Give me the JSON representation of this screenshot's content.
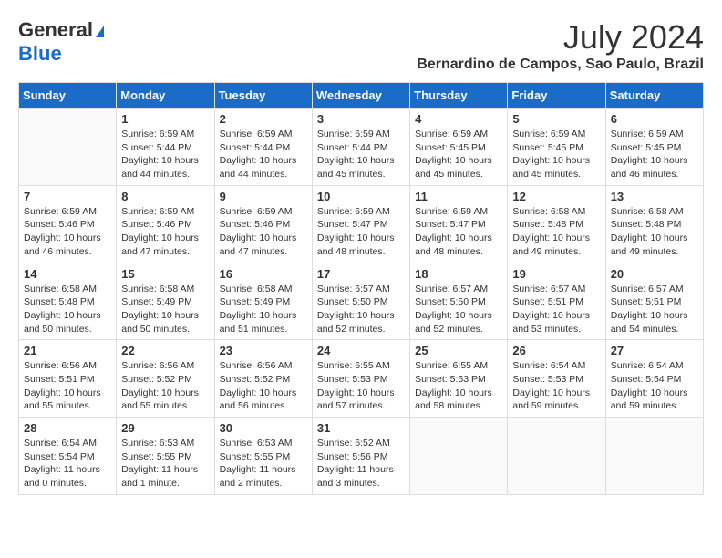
{
  "header": {
    "logo_general": "General",
    "logo_blue": "Blue",
    "month_title": "July 2024",
    "location": "Bernardino de Campos, Sao Paulo, Brazil"
  },
  "days_of_week": [
    "Sunday",
    "Monday",
    "Tuesday",
    "Wednesday",
    "Thursday",
    "Friday",
    "Saturday"
  ],
  "weeks": [
    [
      {
        "day": "",
        "info": ""
      },
      {
        "day": "1",
        "info": "Sunrise: 6:59 AM\nSunset: 5:44 PM\nDaylight: 10 hours\nand 44 minutes."
      },
      {
        "day": "2",
        "info": "Sunrise: 6:59 AM\nSunset: 5:44 PM\nDaylight: 10 hours\nand 44 minutes."
      },
      {
        "day": "3",
        "info": "Sunrise: 6:59 AM\nSunset: 5:44 PM\nDaylight: 10 hours\nand 45 minutes."
      },
      {
        "day": "4",
        "info": "Sunrise: 6:59 AM\nSunset: 5:45 PM\nDaylight: 10 hours\nand 45 minutes."
      },
      {
        "day": "5",
        "info": "Sunrise: 6:59 AM\nSunset: 5:45 PM\nDaylight: 10 hours\nand 45 minutes."
      },
      {
        "day": "6",
        "info": "Sunrise: 6:59 AM\nSunset: 5:45 PM\nDaylight: 10 hours\nand 46 minutes."
      }
    ],
    [
      {
        "day": "7",
        "info": "Sunrise: 6:59 AM\nSunset: 5:46 PM\nDaylight: 10 hours\nand 46 minutes."
      },
      {
        "day": "8",
        "info": "Sunrise: 6:59 AM\nSunset: 5:46 PM\nDaylight: 10 hours\nand 47 minutes."
      },
      {
        "day": "9",
        "info": "Sunrise: 6:59 AM\nSunset: 5:46 PM\nDaylight: 10 hours\nand 47 minutes."
      },
      {
        "day": "10",
        "info": "Sunrise: 6:59 AM\nSunset: 5:47 PM\nDaylight: 10 hours\nand 48 minutes."
      },
      {
        "day": "11",
        "info": "Sunrise: 6:59 AM\nSunset: 5:47 PM\nDaylight: 10 hours\nand 48 minutes."
      },
      {
        "day": "12",
        "info": "Sunrise: 6:58 AM\nSunset: 5:48 PM\nDaylight: 10 hours\nand 49 minutes."
      },
      {
        "day": "13",
        "info": "Sunrise: 6:58 AM\nSunset: 5:48 PM\nDaylight: 10 hours\nand 49 minutes."
      }
    ],
    [
      {
        "day": "14",
        "info": "Sunrise: 6:58 AM\nSunset: 5:48 PM\nDaylight: 10 hours\nand 50 minutes."
      },
      {
        "day": "15",
        "info": "Sunrise: 6:58 AM\nSunset: 5:49 PM\nDaylight: 10 hours\nand 50 minutes."
      },
      {
        "day": "16",
        "info": "Sunrise: 6:58 AM\nSunset: 5:49 PM\nDaylight: 10 hours\nand 51 minutes."
      },
      {
        "day": "17",
        "info": "Sunrise: 6:57 AM\nSunset: 5:50 PM\nDaylight: 10 hours\nand 52 minutes."
      },
      {
        "day": "18",
        "info": "Sunrise: 6:57 AM\nSunset: 5:50 PM\nDaylight: 10 hours\nand 52 minutes."
      },
      {
        "day": "19",
        "info": "Sunrise: 6:57 AM\nSunset: 5:51 PM\nDaylight: 10 hours\nand 53 minutes."
      },
      {
        "day": "20",
        "info": "Sunrise: 6:57 AM\nSunset: 5:51 PM\nDaylight: 10 hours\nand 54 minutes."
      }
    ],
    [
      {
        "day": "21",
        "info": "Sunrise: 6:56 AM\nSunset: 5:51 PM\nDaylight: 10 hours\nand 55 minutes."
      },
      {
        "day": "22",
        "info": "Sunrise: 6:56 AM\nSunset: 5:52 PM\nDaylight: 10 hours\nand 55 minutes."
      },
      {
        "day": "23",
        "info": "Sunrise: 6:56 AM\nSunset: 5:52 PM\nDaylight: 10 hours\nand 56 minutes."
      },
      {
        "day": "24",
        "info": "Sunrise: 6:55 AM\nSunset: 5:53 PM\nDaylight: 10 hours\nand 57 minutes."
      },
      {
        "day": "25",
        "info": "Sunrise: 6:55 AM\nSunset: 5:53 PM\nDaylight: 10 hours\nand 58 minutes."
      },
      {
        "day": "26",
        "info": "Sunrise: 6:54 AM\nSunset: 5:53 PM\nDaylight: 10 hours\nand 59 minutes."
      },
      {
        "day": "27",
        "info": "Sunrise: 6:54 AM\nSunset: 5:54 PM\nDaylight: 10 hours\nand 59 minutes."
      }
    ],
    [
      {
        "day": "28",
        "info": "Sunrise: 6:54 AM\nSunset: 5:54 PM\nDaylight: 11 hours\nand 0 minutes."
      },
      {
        "day": "29",
        "info": "Sunrise: 6:53 AM\nSunset: 5:55 PM\nDaylight: 11 hours\nand 1 minute."
      },
      {
        "day": "30",
        "info": "Sunrise: 6:53 AM\nSunset: 5:55 PM\nDaylight: 11 hours\nand 2 minutes."
      },
      {
        "day": "31",
        "info": "Sunrise: 6:52 AM\nSunset: 5:56 PM\nDaylight: 11 hours\nand 3 minutes."
      },
      {
        "day": "",
        "info": ""
      },
      {
        "day": "",
        "info": ""
      },
      {
        "day": "",
        "info": ""
      }
    ]
  ]
}
